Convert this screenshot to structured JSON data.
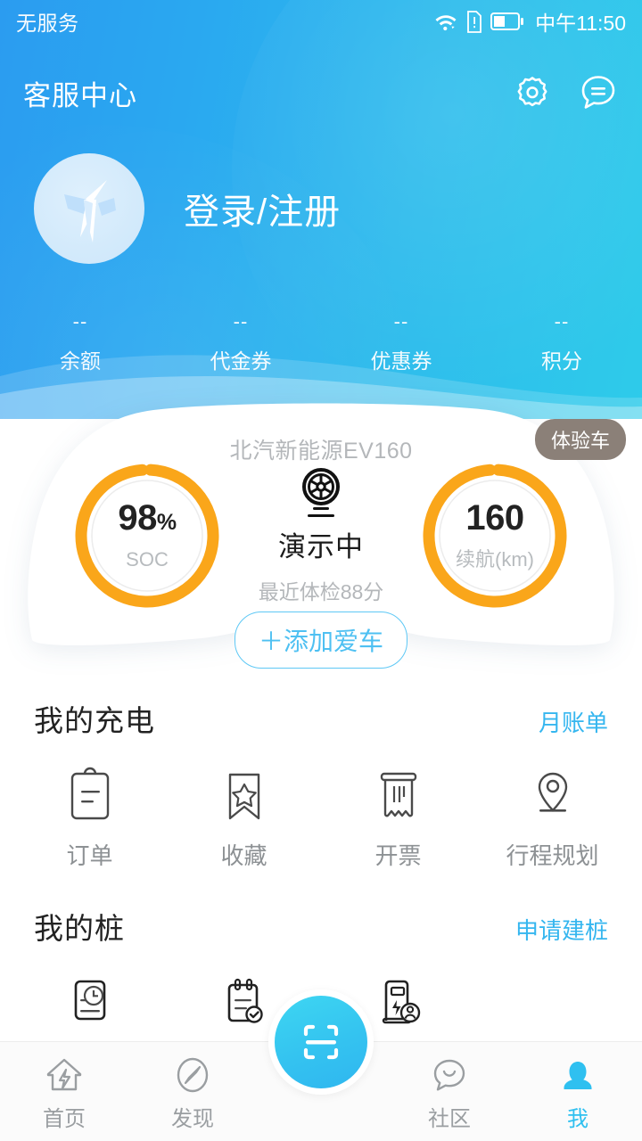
{
  "statusbar": {
    "carrier": "无服务",
    "time": "中午11:50",
    "icons": [
      "wifi-icon",
      "sim-alert-icon",
      "battery-icon"
    ],
    "battery_percent": 40
  },
  "header": {
    "title": "客服中心",
    "settings_icon": "gear-icon",
    "message_icon": "message-icon",
    "gradient_start": "#2b9cf0",
    "gradient_end": "#2ecbea"
  },
  "profile": {
    "avatar_icon": "brand-logo-icon",
    "login_label": "登录/注册"
  },
  "stats": [
    {
      "value": "--",
      "label": "余额"
    },
    {
      "value": "--",
      "label": "代金券"
    },
    {
      "value": "--",
      "label": "优惠券"
    },
    {
      "value": "--",
      "label": "积分"
    }
  ],
  "car": {
    "model": "北汽新能源EV160",
    "badge": "体验车",
    "status": "演示中",
    "status_icon": "tire-icon",
    "checkup": "最近体检88分",
    "add_button": "＋添加爱车",
    "gauge_color": "#faa61a",
    "soc": {
      "value": "98",
      "unit": "%",
      "label": "SOC",
      "percent": 98
    },
    "range": {
      "value": "160",
      "unit": "",
      "label": "续航(km)",
      "percent": 98
    }
  },
  "charging_section": {
    "title": "我的充电",
    "link": "月账单",
    "items": [
      {
        "label": "订单",
        "icon": "clipboard-icon"
      },
      {
        "label": "收藏",
        "icon": "bookmark-star-icon"
      },
      {
        "label": "开票",
        "icon": "invoice-icon"
      },
      {
        "label": "行程规划",
        "icon": "map-pin-icon"
      }
    ]
  },
  "pile_section": {
    "title": "我的桩",
    "link": "申请建桩",
    "items": [
      {
        "label": "",
        "icon": "clock-record-icon"
      },
      {
        "label": "",
        "icon": "checklist-icon"
      },
      {
        "label": "",
        "icon": "charger-user-icon"
      }
    ]
  },
  "tabbar": {
    "active_color": "#2fc0f0",
    "scan_icon": "scan-icon",
    "tabs": [
      {
        "label": "首页",
        "icon": "home-bolt-icon",
        "active": false
      },
      {
        "label": "发现",
        "icon": "compass-icon",
        "active": false
      },
      {
        "label": "社区",
        "icon": "chat-smile-icon",
        "active": false
      },
      {
        "label": "我",
        "icon": "person-icon",
        "active": true
      }
    ]
  }
}
